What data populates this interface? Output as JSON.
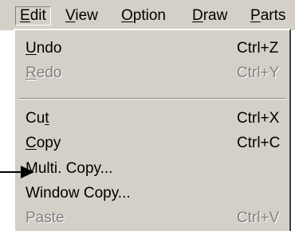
{
  "menubar": {
    "items": [
      {
        "label": "Edit",
        "mnemonic": "E",
        "rest": "dit"
      },
      {
        "label": "View",
        "mnemonic": "V",
        "rest": "iew"
      },
      {
        "label": "Option",
        "mnemonic": "O",
        "rest": "ption"
      },
      {
        "label": "Draw",
        "mnemonic": "D",
        "rest": "raw"
      },
      {
        "label": "Parts",
        "mnemonic": "P",
        "rest": "arts"
      }
    ]
  },
  "edit_menu": {
    "undo": {
      "pre": "",
      "mnemonic": "U",
      "post": "ndo",
      "shortcut": "Ctrl+Z"
    },
    "redo": {
      "pre": "",
      "mnemonic": "R",
      "post": "edo",
      "shortcut": "Ctrl+Y"
    },
    "cut": {
      "pre": "Cu",
      "mnemonic": "t",
      "post": "",
      "shortcut": "Ctrl+X"
    },
    "copy": {
      "pre": "",
      "mnemonic": "C",
      "post": "opy",
      "shortcut": "Ctrl+C"
    },
    "multi_copy": {
      "label": "Multi. Copy..."
    },
    "window_copy": {
      "label": "Window Copy..."
    },
    "paste": {
      "label": "Paste",
      "shortcut": "Ctrl+V"
    }
  },
  "colors": {
    "menu_bg": "#d4d0c8",
    "disabled": "#808080"
  }
}
